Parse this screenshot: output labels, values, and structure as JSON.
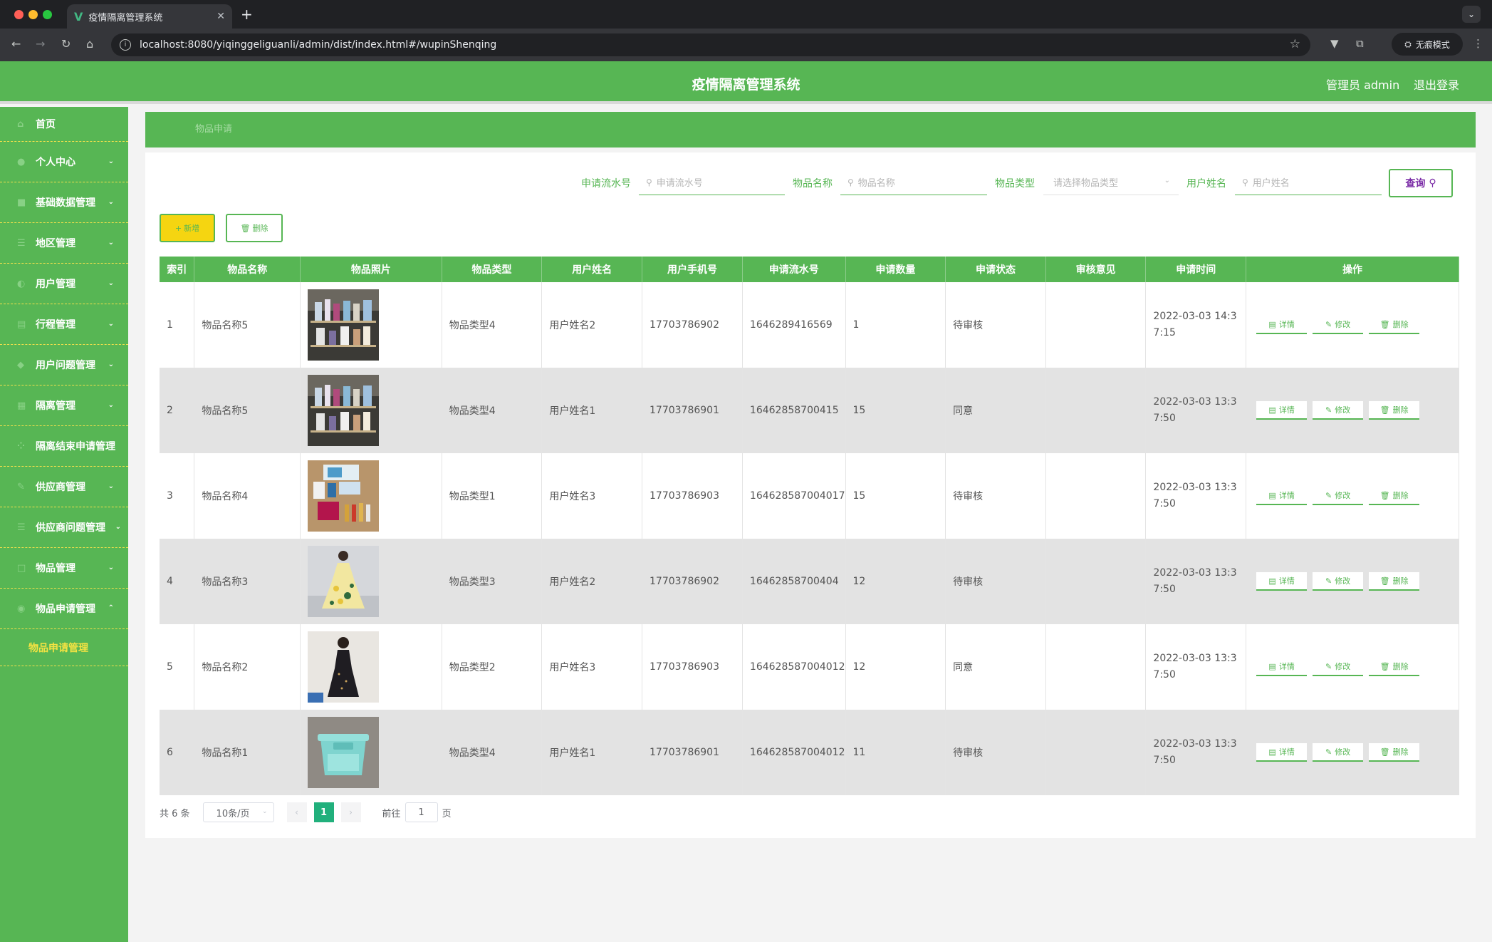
{
  "browser": {
    "tab_title": "疫情隔离管理系统",
    "url": "localhost:8080/yiqinggeliguanli/admin/dist/index.html#/wupinShenqing",
    "incognito_label": "无痕模式"
  },
  "header": {
    "title": "疫情隔离管理系统",
    "user": "管理员 admin",
    "logout": "退出登录"
  },
  "sidebar": {
    "items": [
      {
        "label": "首页",
        "icon": "home-icon"
      },
      {
        "label": "个人中心",
        "icon": "user-icon"
      },
      {
        "label": "基础数据管理",
        "icon": "data-icon"
      },
      {
        "label": "地区管理",
        "icon": "list-icon"
      },
      {
        "label": "用户管理",
        "icon": "users-icon"
      },
      {
        "label": "行程管理",
        "icon": "route-icon"
      },
      {
        "label": "用户问题管理",
        "icon": "question-icon"
      },
      {
        "label": "隔离管理",
        "icon": "isolation-icon"
      },
      {
        "label": "隔离结束申请管理",
        "icon": "grid-icon"
      },
      {
        "label": "供应商管理",
        "icon": "supplier-icon"
      },
      {
        "label": "供应商问题管理",
        "icon": "menu-icon"
      },
      {
        "label": "物品管理",
        "icon": "goods-icon"
      },
      {
        "label": "物品申请管理",
        "icon": "apply-icon"
      }
    ],
    "submenu": "物品申请管理"
  },
  "breadcrumb": "物品申请",
  "filters": {
    "serial_label": "申请流水号",
    "serial_placeholder": "申请流水号",
    "name_label": "物品名称",
    "name_placeholder": "物品名称",
    "type_label": "物品类型",
    "type_placeholder": "请选择物品类型",
    "user_label": "用户姓名",
    "user_placeholder": "用户姓名",
    "search_button": "查询"
  },
  "actions": {
    "add": "新增",
    "delete": "删除"
  },
  "table": {
    "headers": [
      "索引",
      "物品名称",
      "物品照片",
      "物品类型",
      "用户姓名",
      "用户手机号",
      "申请流水号",
      "申请数量",
      "申请状态",
      "审核意见",
      "申请时间",
      "操作"
    ],
    "row_actions": {
      "detail": "详情",
      "edit": "修改",
      "delete": "删除"
    },
    "rows": [
      {
        "idx": "1",
        "name": "物品名称5",
        "photo": "shelf",
        "type": "物品类型4",
        "user": "用户姓名2",
        "phone": "17703786902",
        "serial": "1646289416569",
        "qty": "1",
        "status": "待审核",
        "opinion": "",
        "time": "2022-03-03 14:3\n7:15"
      },
      {
        "idx": "2",
        "name": "物品名称5",
        "photo": "shelf",
        "type": "物品类型4",
        "user": "用户姓名1",
        "phone": "17703786901",
        "serial": "16462858700415",
        "qty": "15",
        "status": "同意",
        "opinion": "",
        "time": "2022-03-03 13:3\n7:50"
      },
      {
        "idx": "3",
        "name": "物品名称4",
        "photo": "cosmetics",
        "type": "物品类型1",
        "user": "用户姓名3",
        "phone": "17703786903",
        "serial": "164628587004017",
        "qty": "15",
        "status": "待审核",
        "opinion": "",
        "time": "2022-03-03 13:3\n7:50"
      },
      {
        "idx": "4",
        "name": "物品名称3",
        "photo": "dress-yellow",
        "type": "物品类型3",
        "user": "用户姓名2",
        "phone": "17703786902",
        "serial": "16462858700404",
        "qty": "12",
        "status": "待审核",
        "opinion": "",
        "time": "2022-03-03 13:3\n7:50"
      },
      {
        "idx": "5",
        "name": "物品名称2",
        "photo": "dress-black",
        "type": "物品类型2",
        "user": "用户姓名3",
        "phone": "17703786903",
        "serial": "164628587004012",
        "qty": "12",
        "status": "同意",
        "opinion": "",
        "time": "2022-03-03 13:3\n7:50"
      },
      {
        "idx": "6",
        "name": "物品名称1",
        "photo": "plastic-box",
        "type": "物品类型4",
        "user": "用户姓名1",
        "phone": "17703786901",
        "serial": "164628587004012",
        "qty": "11",
        "status": "待审核",
        "opinion": "",
        "time": "2022-03-03 13:3\n7:50"
      }
    ]
  },
  "pagination": {
    "total": "共 6 条",
    "page_size": "10条/页",
    "current": "1",
    "goto_label": "前往",
    "goto_value": "1",
    "page_suffix": "页"
  },
  "colors": {
    "primary": "#57b654",
    "accent_yellow": "#f5d511",
    "pager_active": "#21b07c"
  }
}
